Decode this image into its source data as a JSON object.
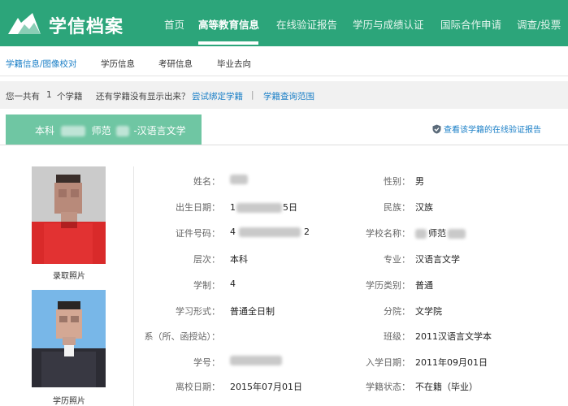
{
  "header": {
    "logo_text": "学信档案",
    "nav": [
      {
        "label": "首页"
      },
      {
        "label": "高等教育信息"
      },
      {
        "label": "在线验证报告"
      },
      {
        "label": "学历与成绩认证"
      },
      {
        "label": "国际合作申请"
      },
      {
        "label": "调查/投票"
      }
    ],
    "active_nav": "高等教育信息"
  },
  "subnav": {
    "items": [
      {
        "label": "学籍信息/图像校对"
      },
      {
        "label": "学历信息"
      },
      {
        "label": "考研信息"
      },
      {
        "label": "毕业去向"
      }
    ],
    "active": "学籍信息/图像校对"
  },
  "count_row": {
    "prefix": "您一共有",
    "count": "1",
    "suffix": "个学籍",
    "question": "还有学籍没有显示出来？",
    "bind_link": "尝试绑定学籍",
    "separator": "|",
    "range_link": "学籍查询范围"
  },
  "tab": {
    "level": "本科",
    "school_suffix": "师范",
    "major": "-汉语言文学",
    "verify_link": "查看该学籍的在线验证报告"
  },
  "photos": {
    "photo1_label": "录取照片",
    "photo2_label": "学历照片"
  },
  "fields": {
    "name": {
      "label": "姓名：",
      "value": ""
    },
    "gender": {
      "label": "性别：",
      "value": "男"
    },
    "birth": {
      "label": "出生日期：",
      "value_prefix": "1",
      "value_suffix": "5日"
    },
    "ethnicity": {
      "label": "民族：",
      "value": "汉族"
    },
    "id_number": {
      "label": "证件号码：",
      "value_prefix": "4",
      "value_suffix": "2"
    },
    "school": {
      "label": "学校名称：",
      "value": "师范"
    },
    "level": {
      "label": "层次：",
      "value": "本科"
    },
    "major": {
      "label": "专业：",
      "value": "汉语言文学"
    },
    "duration": {
      "label": "学制：",
      "value": "4"
    },
    "degree_type": {
      "label": "学历类别：",
      "value": "普通"
    },
    "study_mode": {
      "label": "学习形式：",
      "value": "普通全日制"
    },
    "college": {
      "label": "分院：",
      "value": "文学院"
    },
    "department": {
      "label": "系（所、函授站）：",
      "value": ""
    },
    "class": {
      "label": "班级：",
      "value": "2011汉语言文学本"
    },
    "student_id": {
      "label": "学号：",
      "value": ""
    },
    "enroll_date": {
      "label": "入学日期：",
      "value": "2011年09月01日"
    },
    "leave_date": {
      "label": "离校日期：",
      "value": "2015年07月01日"
    },
    "status": {
      "label": "学籍状态：",
      "value": "不在籍（毕业）"
    }
  },
  "colors": {
    "header_green": "#2ca57a",
    "tab_green": "#6fc6a3",
    "link_blue": "#1a7fc7"
  }
}
